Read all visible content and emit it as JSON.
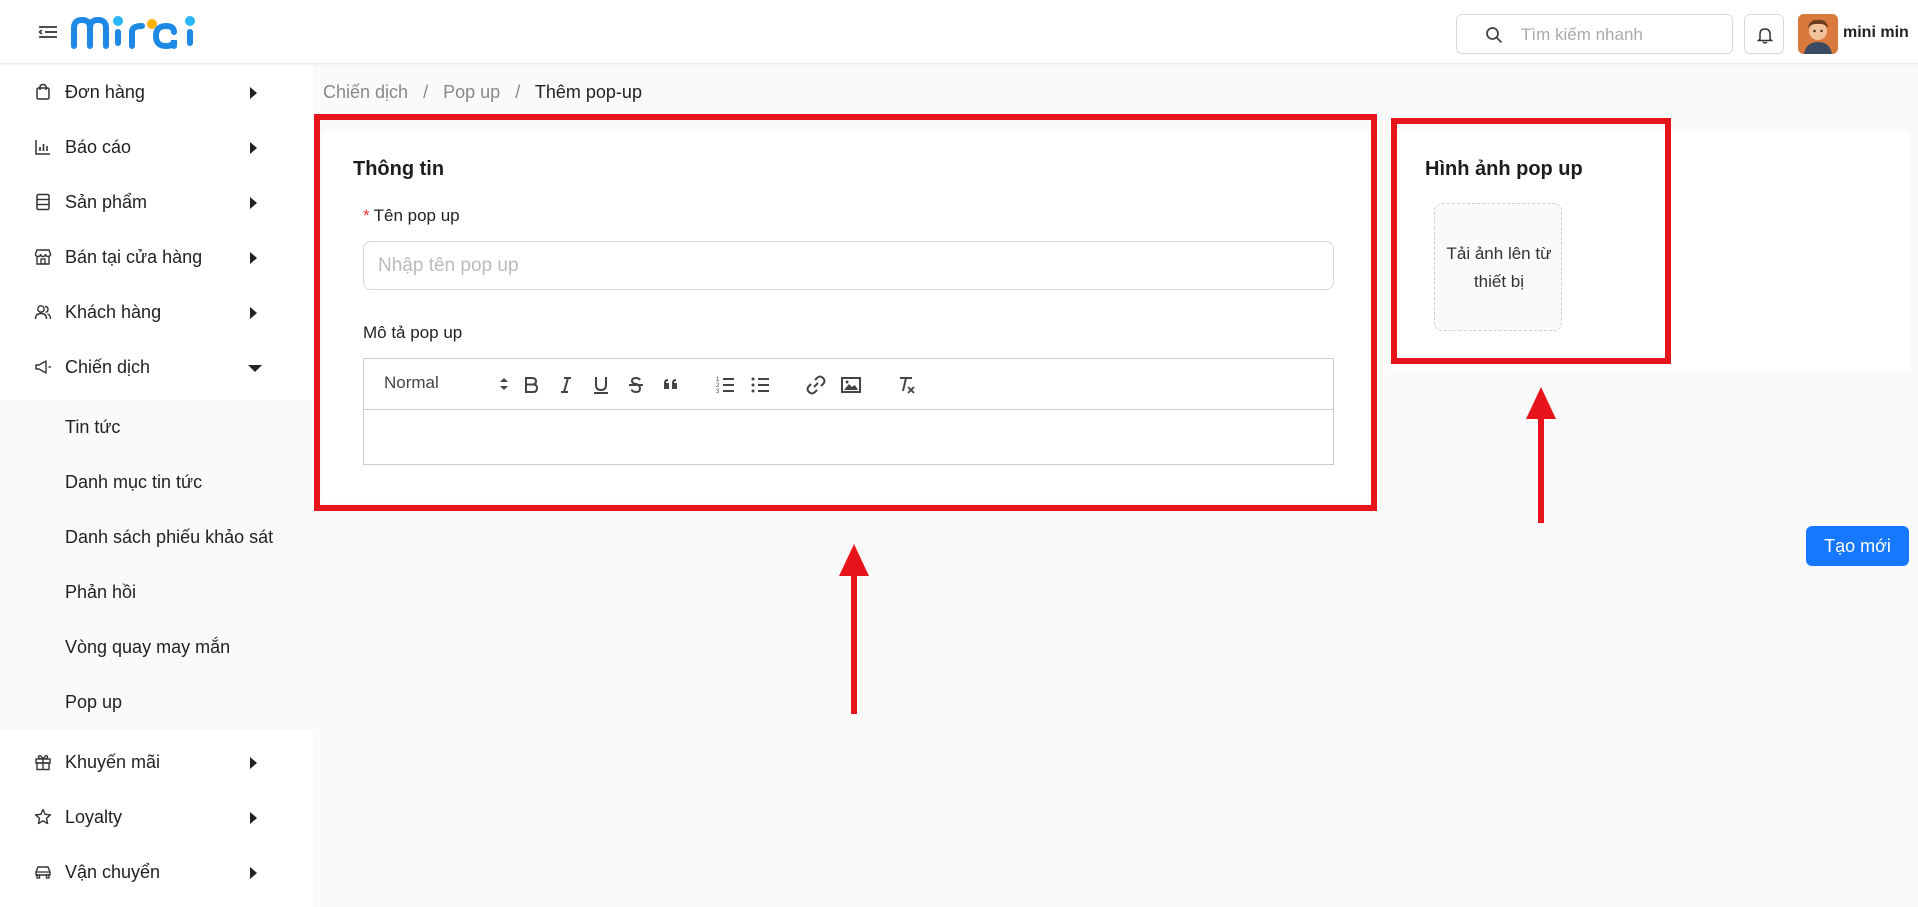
{
  "header": {
    "logo_text": "mirai",
    "search": {
      "placeholder": "Tìm kiếm nhanh"
    },
    "user": {
      "name": "mini min"
    }
  },
  "sidebar": {
    "items": [
      {
        "label": "Đơn hàng",
        "icon": "shopping-bag-icon"
      },
      {
        "label": "Báo cáo",
        "icon": "bar-chart-icon"
      },
      {
        "label": "Sản phẩm",
        "icon": "product-icon"
      },
      {
        "label": "Bán tại cửa hàng",
        "icon": "store-icon"
      },
      {
        "label": "Khách hàng",
        "icon": "customers-icon"
      },
      {
        "label": "Chiến dịch",
        "icon": "megaphone-icon",
        "expanded": true
      },
      {
        "label": "Khuyến mãi",
        "icon": "gift-icon"
      },
      {
        "label": "Loyalty",
        "icon": "star-icon"
      },
      {
        "label": "Vận chuyển",
        "icon": "car-icon"
      }
    ],
    "submenu": [
      {
        "label": "Tin tức"
      },
      {
        "label": "Danh mục tin tức"
      },
      {
        "label": "Danh sách phiếu khảo sát"
      },
      {
        "label": "Phản hồi"
      },
      {
        "label": "Vòng quay may mắn"
      },
      {
        "label": "Pop up"
      }
    ]
  },
  "breadcrumb": [
    "Chiến dịch",
    "Pop up",
    "Thêm pop-up"
  ],
  "breadcrumb_separator": "/",
  "info_card": {
    "title": "Thông tin",
    "name_label": "Tên pop up",
    "name_required_mark": "*",
    "name_placeholder": "Nhập tên pop up",
    "desc_label": "Mô tả pop up",
    "editor": {
      "format_select": "Normal",
      "tools": [
        "bold-icon",
        "italic-icon",
        "underline-icon",
        "strikethrough-icon",
        "quote-icon",
        "ordered-list-icon",
        "bullet-list-icon",
        "link-icon",
        "image-icon",
        "clear-format-icon"
      ]
    }
  },
  "image_card": {
    "title": "Hình ảnh pop up",
    "upload_text": "Tải ảnh lên từ thiết bị"
  },
  "actions": {
    "create_label": "Tạo mới"
  },
  "colors": {
    "primary": "#1677ff",
    "annotation": "#e8141b",
    "logo": "#1e88e5"
  }
}
